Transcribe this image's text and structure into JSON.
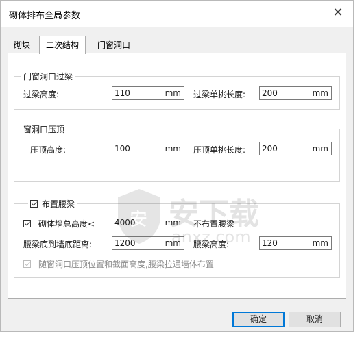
{
  "window": {
    "title": "砌体排布全局参数",
    "close_glyph": "✕"
  },
  "tabs": [
    {
      "label": "砌块",
      "active": false
    },
    {
      "label": "二次结构",
      "active": true
    },
    {
      "label": "门窗洞口",
      "active": false
    }
  ],
  "lintel": {
    "legend": "门窗洞口过梁",
    "height_label": "过梁高度:",
    "height_value": "110",
    "height_unit": "mm",
    "single_pick_label": "过梁单挑长度:",
    "single_pick_value": "200",
    "single_pick_unit": "mm"
  },
  "window_top": {
    "legend": "窗洞口压顶",
    "height_label": "压顶高度:",
    "height_value": "100",
    "height_unit": "mm",
    "single_pick_label": "压顶单挑长度:",
    "single_pick_value": "200",
    "single_pick_unit": "mm"
  },
  "waist_beam": {
    "legend_checkbox_label": "布置腰梁",
    "legend_checked": true,
    "wall_height_check_label": "砌体墙总高度<",
    "wall_height_checked": true,
    "wall_height_value": "4000",
    "wall_height_unit": "mm",
    "no_beam_note": "不布置腰梁",
    "bottom_dist_label": "腰梁底到墙底距离:",
    "bottom_dist_value": "1200",
    "bottom_dist_unit": "mm",
    "beam_height_label": "腰梁高度:",
    "beam_height_value": "120",
    "beam_height_unit": "mm",
    "follow_label": "随窗洞口压顶位置和截面高度,腰梁拉通墙体布置",
    "follow_checked": true,
    "follow_disabled": true
  },
  "buttons": {
    "ok": "确定",
    "cancel": "取消"
  },
  "watermark": {
    "brand": "安下载",
    "domain": "anxz.com",
    "shield_char": "安"
  },
  "colors": {
    "accent": "#0078d7",
    "panel_bg": "#ffffff",
    "dialog_bg": "#f0f0f0"
  }
}
